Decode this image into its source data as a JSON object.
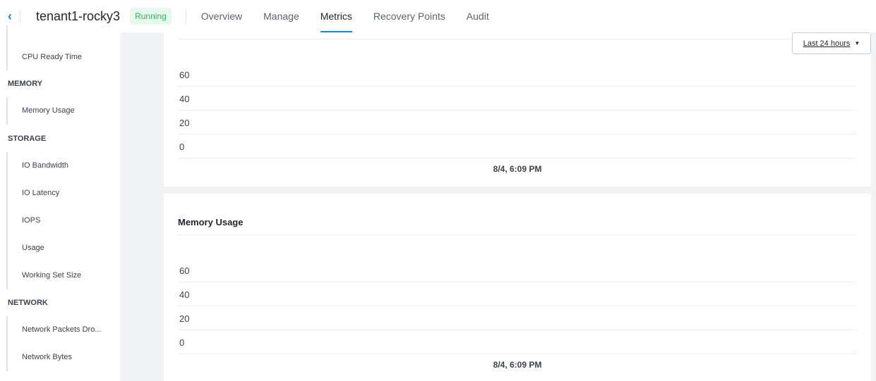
{
  "header": {
    "title": "tenant1-rocky3",
    "status": "Running",
    "tabs": [
      "Overview",
      "Manage",
      "Metrics",
      "Recovery Points",
      "Audit"
    ],
    "active_tab": "Metrics"
  },
  "sidebar": {
    "cpu_items": [
      "CPU Ready Time"
    ],
    "memory": {
      "label": "MEMORY",
      "items": [
        "Memory Usage"
      ]
    },
    "storage": {
      "label": "STORAGE",
      "items": [
        "IO Bandwidth",
        "IO Latency",
        "IOPS",
        "Usage",
        "Working Set Size"
      ]
    },
    "network": {
      "label": "NETWORK",
      "items": [
        "Network Packets Dro...",
        "Network Bytes"
      ]
    }
  },
  "time_range": "Last 24 hours",
  "charts": [
    {
      "title": "",
      "y_ticks": [
        "60",
        "40",
        "20",
        "0"
      ],
      "x_label": "8/4, 6:09 PM"
    },
    {
      "title": "Memory Usage",
      "y_ticks": [
        "60",
        "40",
        "20",
        "0"
      ],
      "x_label": "8/4, 6:09 PM"
    }
  ]
}
